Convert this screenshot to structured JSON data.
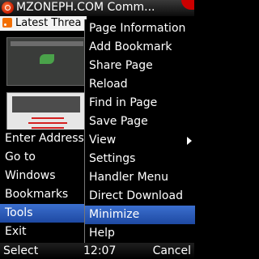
{
  "titlebar": {
    "title": "MZONEPH.COM Comm..."
  },
  "webpage": {
    "tab_label": "Latest Threa"
  },
  "menu": {
    "items": [
      {
        "label": "Enter Address"
      },
      {
        "label": "Go to"
      },
      {
        "label": "Windows"
      },
      {
        "label": "Bookmarks"
      },
      {
        "label": "Tools",
        "selected": true
      },
      {
        "label": "Exit"
      }
    ]
  },
  "submenu": {
    "items": [
      {
        "label": "Page Information"
      },
      {
        "label": "Add Bookmark"
      },
      {
        "label": "Share Page"
      },
      {
        "label": "Reload"
      },
      {
        "label": "Find in Page"
      },
      {
        "label": "Save Page"
      },
      {
        "label": "View",
        "has_submenu": true
      },
      {
        "label": "Settings"
      },
      {
        "label": "Handler Menu"
      },
      {
        "label": "Direct Download"
      },
      {
        "label": "Minimize",
        "selected": true
      },
      {
        "label": "Help"
      }
    ]
  },
  "softkeys": {
    "left": "Select",
    "time": "12:07",
    "right": "Cancel"
  },
  "colors": {
    "highlight": "#2f5fc4",
    "background": "#000000",
    "text": "#ffffff",
    "accent_red": "#c00000"
  }
}
